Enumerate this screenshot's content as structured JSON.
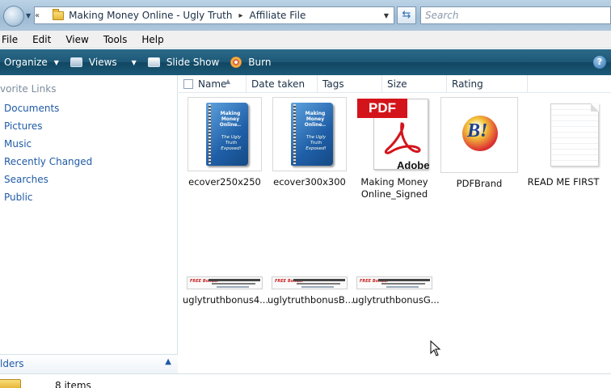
{
  "address": {
    "breadcrumb_sep": "«",
    "path": [
      "Making Money Online - Ugly Truth",
      "Affiliate File"
    ],
    "search_placeholder": "Search"
  },
  "menu": [
    "File",
    "Edit",
    "View",
    "Tools",
    "Help"
  ],
  "toolbar": {
    "organize": "Organize",
    "views": "Views",
    "slideshow": "Slide Show",
    "burn": "Burn",
    "help": "?"
  },
  "favorites": {
    "header": "vorite Links",
    "items": [
      "Documents",
      "Pictures",
      "Music",
      "Recently Changed",
      "Searches",
      "Public"
    ],
    "folders_label": "lders"
  },
  "columns": [
    "Name",
    "Date taken",
    "Tags",
    "Size",
    "Rating"
  ],
  "files": [
    {
      "name": "ecover250x250",
      "kind": "ecover"
    },
    {
      "name": "ecover300x300",
      "kind": "ecover"
    },
    {
      "name": "Making Money Online_Signed",
      "kind": "pdf"
    },
    {
      "name": "PDFBrand",
      "kind": "brand"
    },
    {
      "name": "READ ME FIRST",
      "kind": "document"
    },
    {
      "name": "uglytruthbonus4...",
      "kind": "banner"
    },
    {
      "name": "uglytruthbonusB...",
      "kind": "banner"
    },
    {
      "name": "uglytruthbonusG...",
      "kind": "banner"
    }
  ],
  "thumb_text": {
    "ecover_title": "Making Money Online..",
    "ecover_sub": "The Ugly Truth Exposed!",
    "pdf_tag": "PDF",
    "adobe": "Adobe",
    "brand_letter": "B!",
    "banner_free": "FREE Bonus!"
  },
  "status": {
    "item_count": "8 items"
  }
}
